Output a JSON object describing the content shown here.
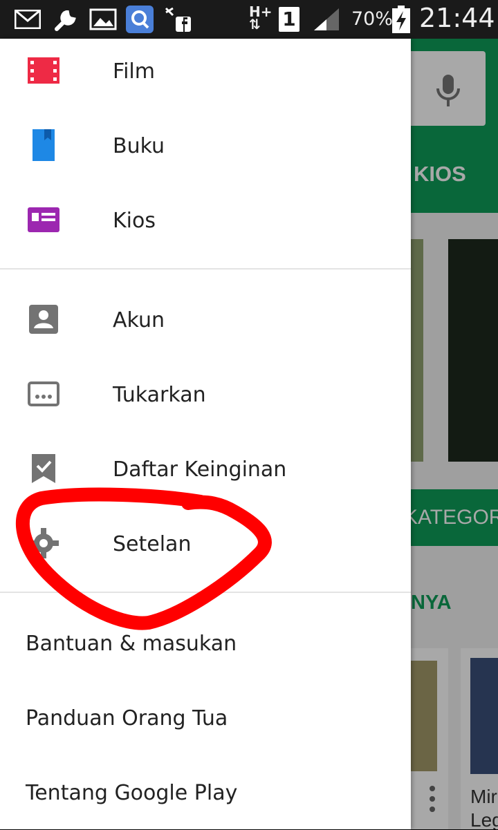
{
  "status_bar": {
    "battery": "70%",
    "time": "21:44",
    "network_type": "H+",
    "sim": "1",
    "icons": [
      "mail-icon",
      "wrench-icon",
      "image-icon",
      "search-app-icon",
      "facebook-transfer-icon",
      "network-hplus-icon",
      "sim-1-icon",
      "signal-icon",
      "battery-charging-icon"
    ]
  },
  "background_app": {
    "tab_label": "KIOS",
    "section_label": "KATEGOR",
    "heading_fragment": "NYA",
    "card_title_fragment": "Mir\nLeg"
  },
  "drawer": {
    "top_items": [
      {
        "label": "Film",
        "icon": "movie-icon",
        "color": "#ee2a45"
      },
      {
        "label": "Buku",
        "icon": "book-icon",
        "color": "#1e88e5"
      },
      {
        "label": "Kios",
        "icon": "newsstand-icon",
        "color": "#9c27b0"
      }
    ],
    "account_items": [
      {
        "label": "Akun",
        "icon": "account-icon"
      },
      {
        "label": "Tukarkan",
        "icon": "redeem-icon"
      },
      {
        "label": "Daftar Keinginan",
        "icon": "wishlist-icon"
      },
      {
        "label": "Setelan",
        "icon": "gear-icon"
      }
    ],
    "footer_items": [
      {
        "label": "Bantuan & masukan"
      },
      {
        "label": "Panduan Orang Tua"
      },
      {
        "label": "Tentang Google Play"
      }
    ]
  },
  "colors": {
    "play_green": "#0f9d58",
    "annotation_red": "#ff0000",
    "icon_grey": "#737373"
  }
}
